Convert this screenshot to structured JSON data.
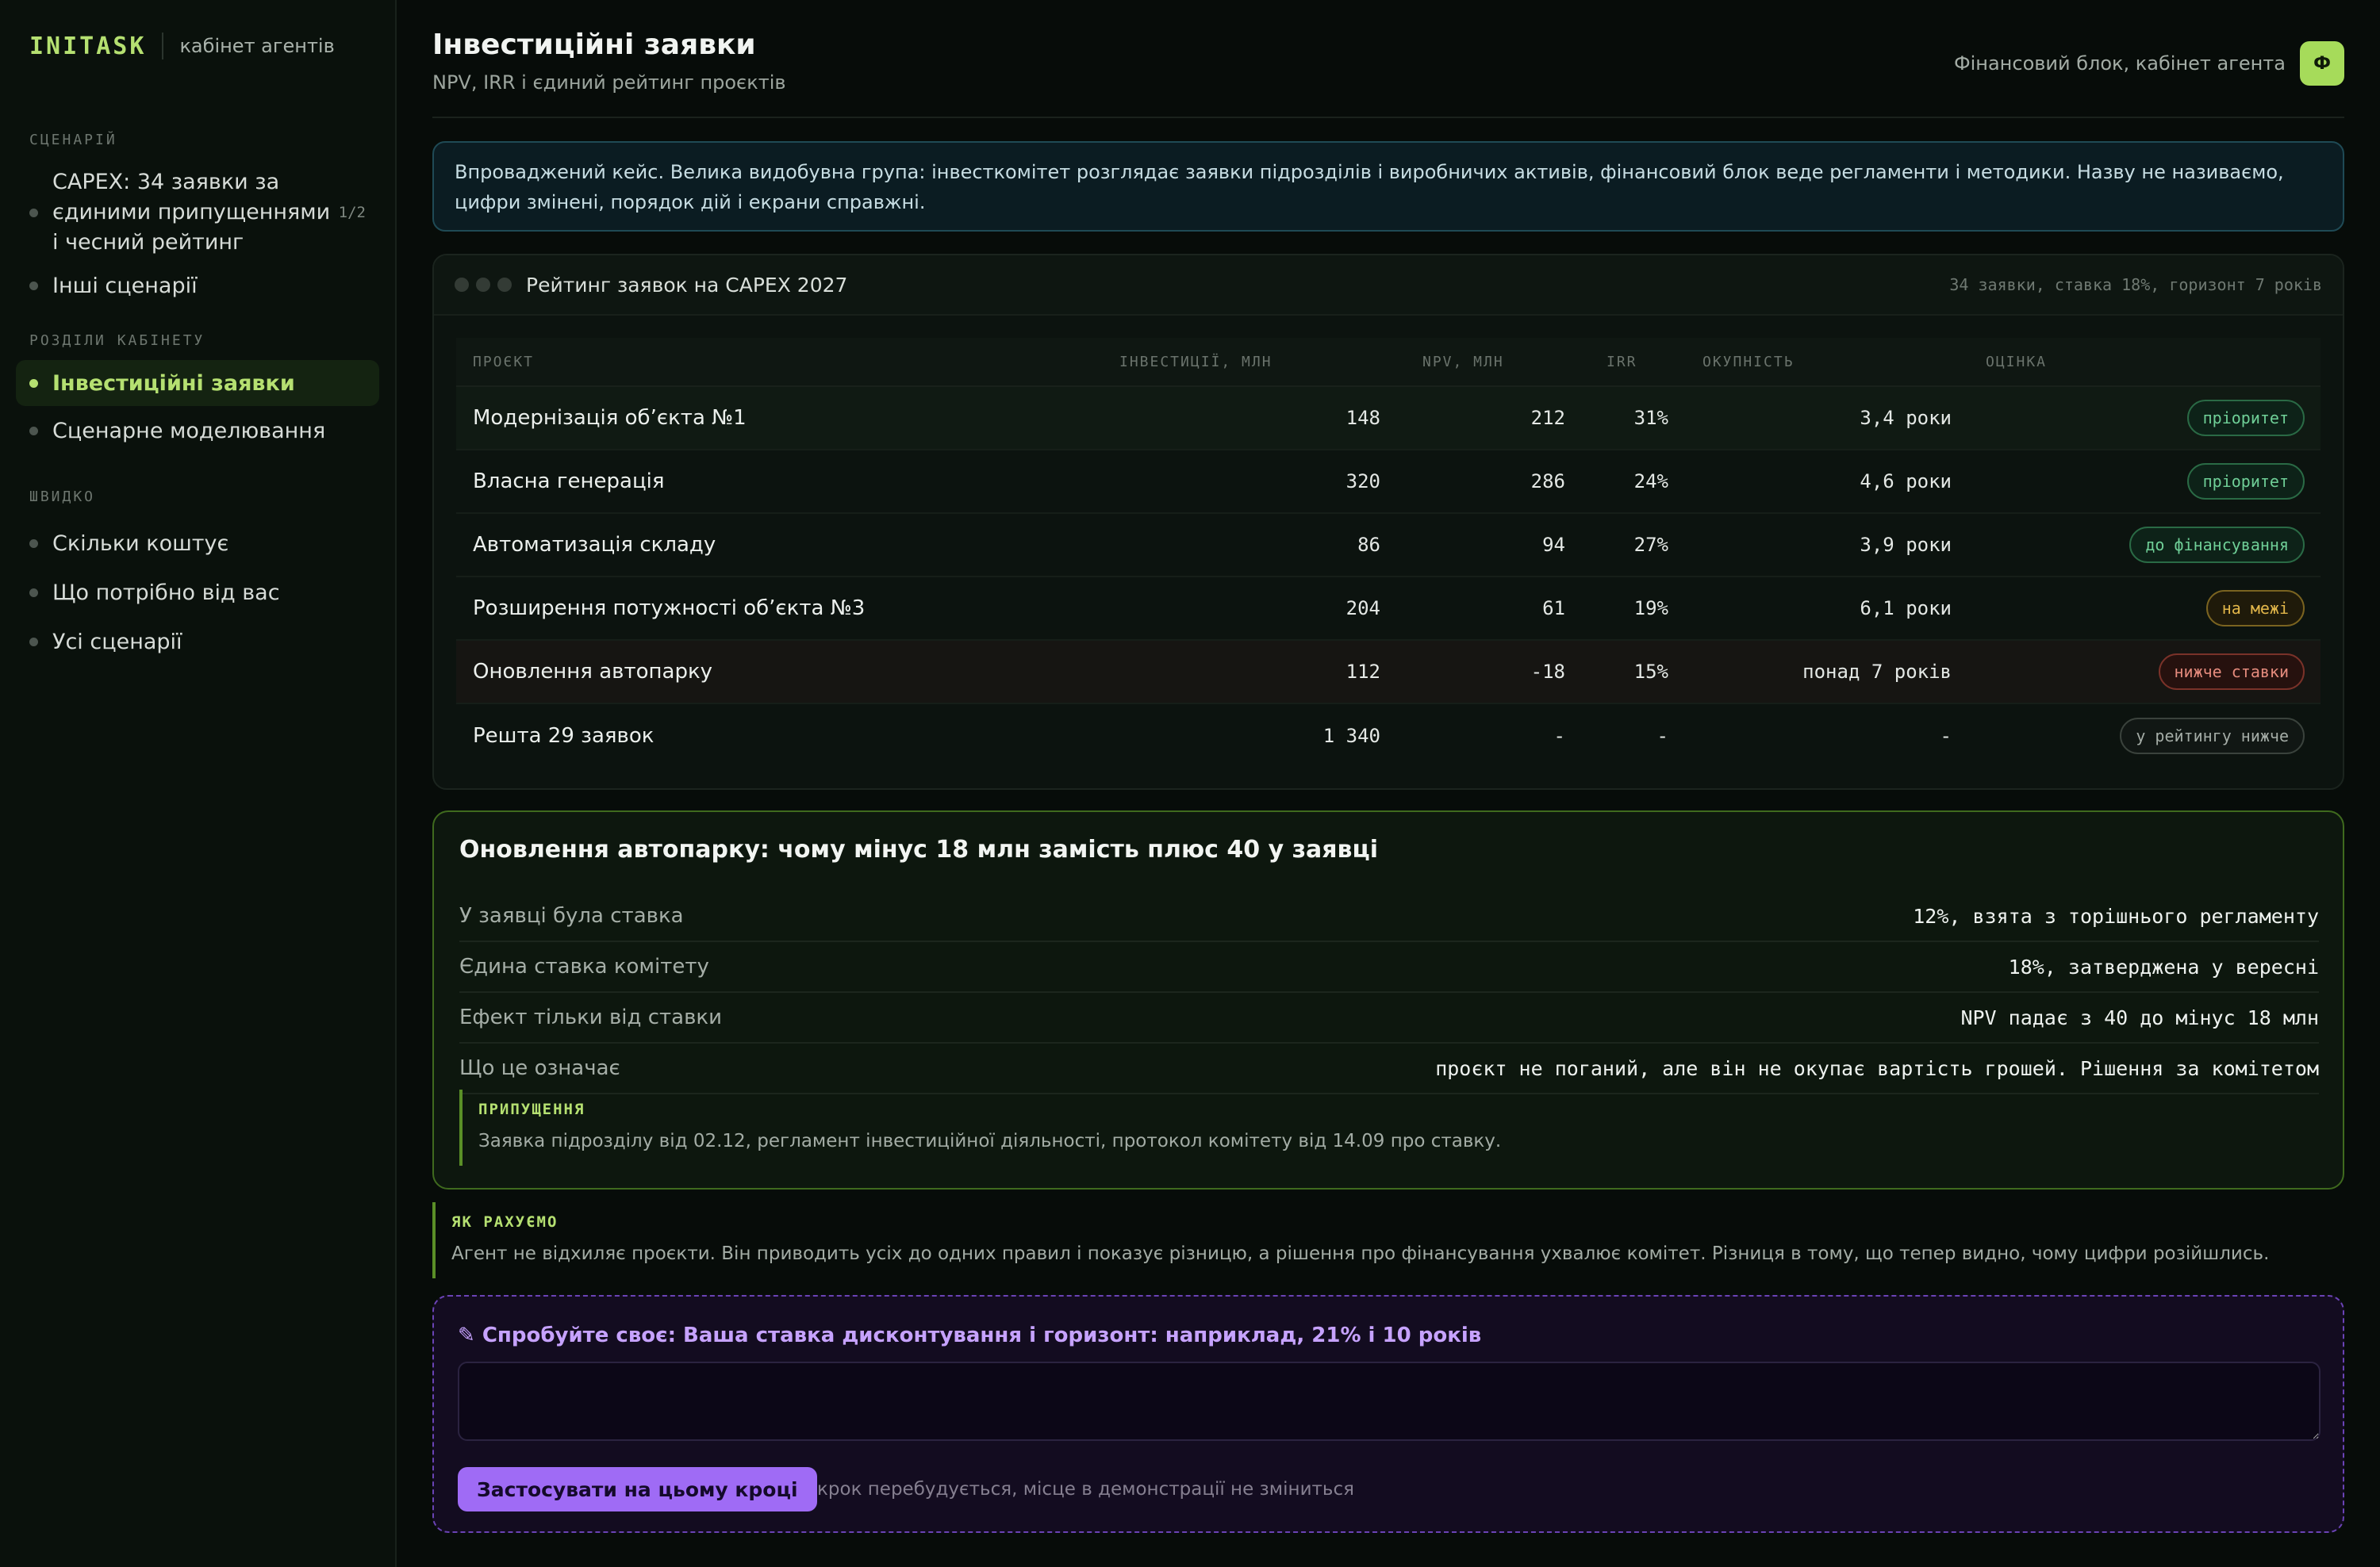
{
  "sidebar": {
    "brand": "INITASK",
    "brand_sub": "кабінет агентів",
    "sections": {
      "scenario_title": "СЦЕНАРІЙ",
      "scenario_item": "CAPEX: 34 заявки за єдиними припущеннями і чесний рейтинг",
      "scenario_count": "1/2",
      "other_scenarios": "Інші сценарії",
      "cabinet_title": "РОЗДІЛИ КАБІНЕТУ",
      "cabinet_items": [
        "Інвестиційні заявки",
        "Сценарне моделювання"
      ],
      "quick_title": "ШВИДКО",
      "quick_items": [
        "Скільки коштує",
        "Що потрібно від вас",
        "Усі сценарії"
      ]
    }
  },
  "header": {
    "title": "Інвестиційні заявки",
    "subtitle": "NPV, IRR і єдиний рейтинг проєктів",
    "right_label": "Фінансовий блок, кабінет агента",
    "avatar": "Ф"
  },
  "info": "Впроваджений кейс. Велика видобувна група: інвесткомітет розглядає заявки підрозділів і виробничих активів, фінансовий блок веде регламенти і методики. Назву не називаємо, цифри змінені, порядок дій і екрани справжні.",
  "table": {
    "title": "Рейтинг заявок на CAPEX 2027",
    "meta": "34 заявки, ставка 18%, горизонт 7 років",
    "columns": [
      "ПРОЄКТ",
      "ІНВЕСТИЦІЇ, МЛН",
      "NPV, МЛН",
      "IRR",
      "ОКУПНІСТЬ",
      "ОЦІНКА"
    ],
    "rows": [
      {
        "name": "Модернізація об’єкта №1",
        "inv": "148",
        "npv": "212",
        "irr": "31%",
        "payback": "3,4 роки",
        "badge": "пріоритет",
        "tone": "green"
      },
      {
        "name": "Власна генерація",
        "inv": "320",
        "npv": "286",
        "irr": "24%",
        "payback": "4,6 роки",
        "badge": "пріоритет",
        "tone": "green"
      },
      {
        "name": "Автоматизація складу",
        "inv": "86",
        "npv": "94",
        "irr": "27%",
        "payback": "3,9 роки",
        "badge": "до фінансування",
        "tone": "green"
      },
      {
        "name": "Розширення потужності об’єкта №3",
        "inv": "204",
        "npv": "61",
        "irr": "19%",
        "payback": "6,1 роки",
        "badge": "на межі",
        "tone": "yellow"
      },
      {
        "name": "Оновлення автопарку",
        "inv": "112",
        "npv": "-18",
        "irr": "15%",
        "payback": "понад 7 років",
        "badge": "нижче ставки",
        "tone": "red"
      },
      {
        "name": "Решта 29 заявок",
        "inv": "1 340",
        "npv": "-",
        "irr": "-",
        "payback": "-",
        "badge": "у рейтингу нижче",
        "tone": "gray"
      }
    ]
  },
  "detail": {
    "title": "Оновлення автопарку: чому мінус 18 млн замість плюс 40 у заявці",
    "rows": [
      {
        "k": "У заявці була ставка",
        "v": "12%, взята з торішнього регламенту"
      },
      {
        "k": "Єдина ставка комітету",
        "v": "18%, затверджена у вересні"
      },
      {
        "k": "Ефект тільки від ставки",
        "v": "NPV падає з 40 до мінус 18 млн"
      },
      {
        "k": "Що це означає",
        "v": "проєкт не поганий, але він не окупає вартість грошей. Рішення за комітетом"
      }
    ],
    "assumptions_title": "ПРИПУЩЕННЯ",
    "assumptions_text": "Заявка підрозділу від 02.12, регламент інвестиційної діяльності, протокол комітету від 14.09 про ставку."
  },
  "how": {
    "title": "ЯК РАХУЄМО",
    "text": "Агент не відхиляє проєкти. Він приводить усіх до одних правил і показує різницю, а рішення про фінансування ухвалює комітет. Різниця в тому, що тепер видно, чому цифри розійшлись."
  },
  "try": {
    "title": "✎ Спробуйте своє: Ваша ставка дисконтування і горизонт: наприклад, 21% і 10 років",
    "input_value": "",
    "button": "Застосувати на цьому кроці",
    "note": "крок перебудується, місце в демонстрації не зміниться"
  }
}
